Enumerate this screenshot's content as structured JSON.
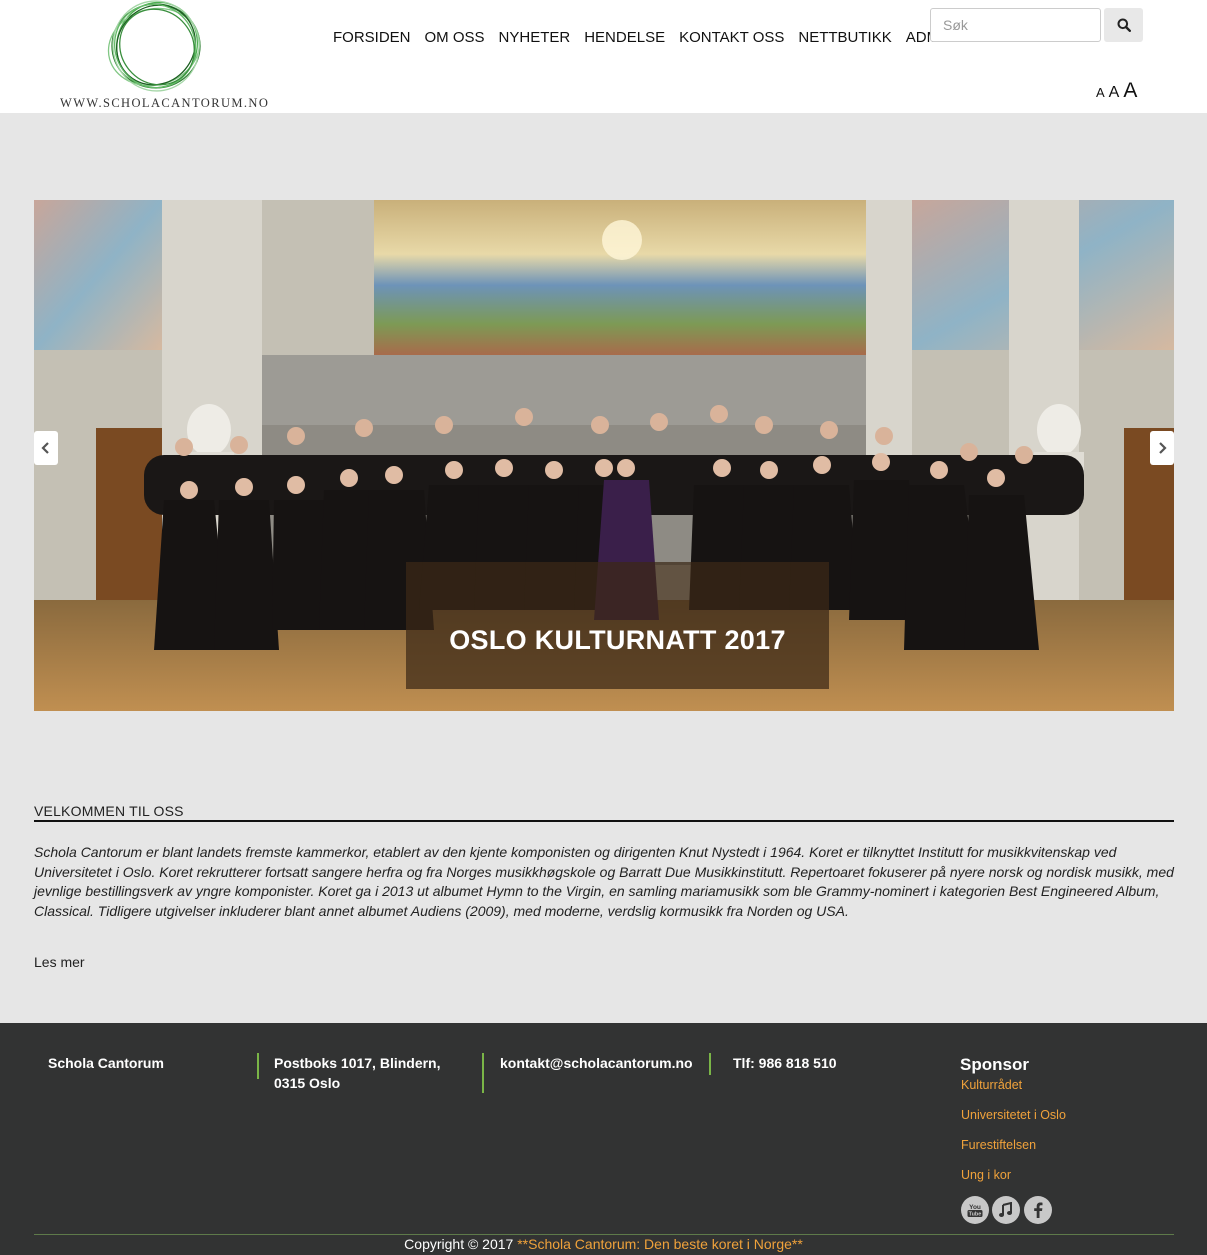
{
  "header": {
    "logo_text": "WWW.SCHOLACANTORUM.NO",
    "nav": [
      "FORSIDEN",
      "OM OSS",
      "NYHETER",
      "HENDELSE",
      "KONTAKT OSS",
      "NETTBUTIKK",
      "ADMIN"
    ],
    "search_placeholder": "Søk",
    "font_sizes": [
      "A",
      "A",
      "A"
    ]
  },
  "carousel": {
    "caption": "OSLO KULTURNATT 2017",
    "prev_icon": "chevron-left-icon",
    "next_icon": "chevron-right-icon"
  },
  "welcome": {
    "title": "VELKOMMEN TIL OSS",
    "text": "Schola Cantorum er blant landets fremste kammerkor, etablert av den kjente komponisten og dirigenten Knut Nystedt i 1964. Koret er tilknyttet Institutt for musikkvitenskap ved Universitetet i Oslo. Koret rekrutterer fortsatt sangere herfra og fra Norges musikkhøgskole og Barratt Due Musikkinstitutt. Repertoaret fokuserer på nyere norsk og nordisk musikk, med jevnlige bestillingsverk av yngre komponister. Koret ga i 2013 ut albumet Hymn to the Virgin, en samling mariamusikk som ble Grammy-nominert i kategorien Best Engineered Album, Classical. Tidligere utgivelser inkluderer blant annet albumet Audiens (2009), med moderne, verdslig kormusikk fra Norden og USA.",
    "read_more": "Les mer"
  },
  "footer": {
    "name": "Schola Cantorum",
    "address": "Postboks 1017, Blindern, 0315 Oslo",
    "email": "kontakt@scholacantorum.no",
    "phone": "Tlf: 986 818 510",
    "sponsor_title": "Sponsor",
    "sponsors": [
      "Kulturrådet",
      "Universitetet i Oslo",
      "Furestiftelsen",
      "Ung i kor"
    ],
    "social_icons": [
      "youtube-icon",
      "music-icon",
      "facebook-icon"
    ],
    "copyright_prefix": "Copyright © 2017",
    "copyright_highlight": "**Schola Cantorum: Den beste koret i Norge**"
  },
  "colors": {
    "accent": "#f0a23b",
    "divider_green": "#7ab547",
    "footer_bg": "#323333",
    "page_bg": "#e6e6e6"
  }
}
